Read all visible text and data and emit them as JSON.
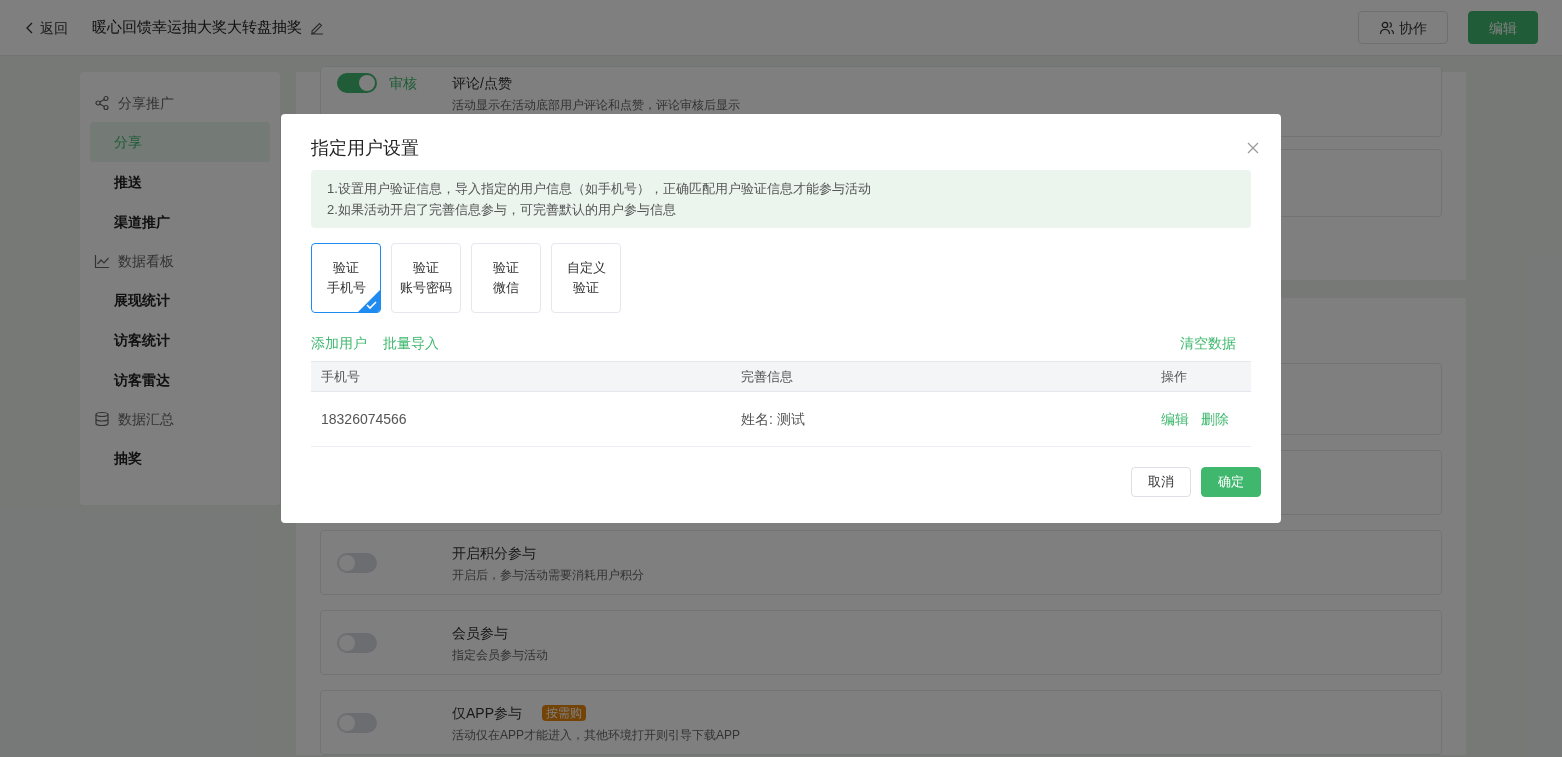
{
  "header": {
    "back": "返回",
    "title": "暖心回馈幸运抽大奖大转盘抽奖",
    "buttons": [
      {
        "label": "协作",
        "kind": "outline"
      },
      {
        "label": "编辑",
        "kind": "primary"
      }
    ]
  },
  "sidebar": [
    {
      "label": "分享推广",
      "kind": "share",
      "items": [
        {
          "label": "分享",
          "selected": true
        },
        {
          "label": "推送",
          "selected": false
        },
        {
          "label": "渠道推广",
          "selected": false
        }
      ]
    },
    {
      "label": "数据看板",
      "kind": "chart",
      "items": [
        {
          "label": "展现统计",
          "selected": false
        },
        {
          "label": "访客统计",
          "selected": false
        },
        {
          "label": "访客雷达",
          "selected": false
        }
      ]
    },
    {
      "label": "数据汇总",
      "kind": "database",
      "items": [
        {
          "label": "抽奖",
          "selected": false
        }
      ]
    }
  ],
  "settings_top": [
    {
      "title": "评论/点赞",
      "description": "活动显示在活动底部用户评论和点赞，评论审核后显示",
      "on": true,
      "status": "审核"
    }
  ],
  "settings_bottom": [
    {
      "title": "开启积分参与",
      "description": "开启后，参与活动需要消耗用户积分",
      "on": false
    },
    {
      "title": "会员参与",
      "description": "指定会员参与活动",
      "on": false
    },
    {
      "title": "仅APP参与",
      "tag": "按需购",
      "description": "活动仅在APP才能进入，其他环境打开则引导下载APP",
      "on": false
    }
  ],
  "dialog": {
    "title": "指定用户设置",
    "notice": [
      "1.设置用户验证信息，导入指定的用户信息（如手机号），正确匹配用户验证信息才能参与活动",
      "2.如果活动开启了完善信息参与，可完善默认的用户参与信息"
    ],
    "options": [
      {
        "lines": [
          "验证",
          "手机号"
        ],
        "selected": true
      },
      {
        "lines": [
          "验证",
          "账号密码"
        ],
        "selected": false
      },
      {
        "lines": [
          "验证",
          "微信"
        ],
        "selected": false
      },
      {
        "lines": [
          "自定义",
          "验证"
        ],
        "selected": false
      }
    ],
    "links_left": [
      "添加用户",
      "批量导入"
    ],
    "link_right": "清空数据",
    "table": {
      "columns": [
        "手机号",
        "完善信息",
        "操作"
      ],
      "rows": [
        {
          "cells": [
            "18326074566",
            "姓名: 测试"
          ],
          "actions": [
            "编辑",
            "删除"
          ]
        }
      ]
    },
    "buttons": [
      {
        "label": "取消",
        "kind": "outline"
      },
      {
        "label": "确定",
        "kind": "primary"
      }
    ]
  }
}
